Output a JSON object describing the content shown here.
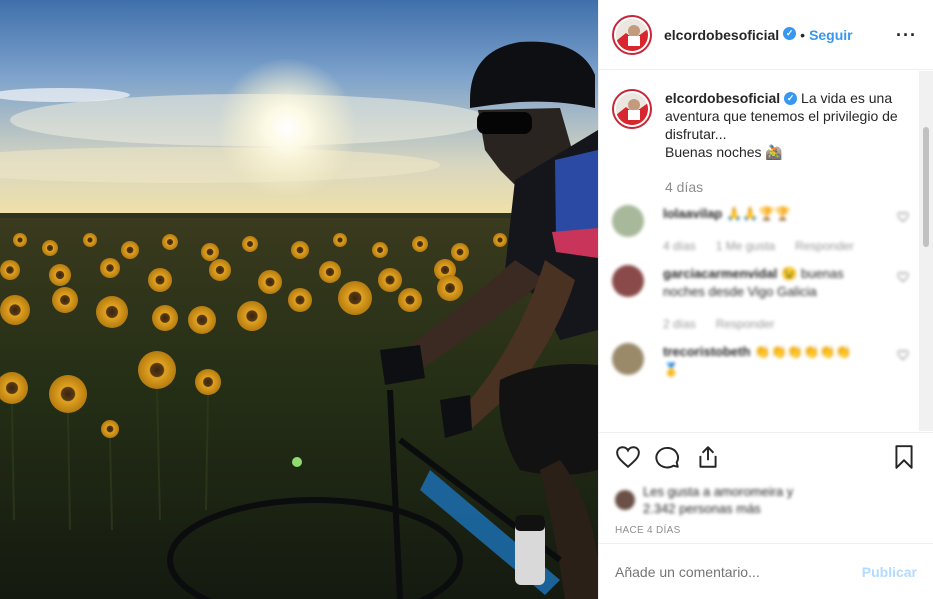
{
  "post": {
    "username": "elcordobesoficial",
    "follow_label": "Seguir",
    "dot": "•",
    "more_icon": "more-options-icon",
    "caption_line1": "La vida es una aventura que tenemos el privilegio de disfrutar...",
    "caption_line2": "Buenas noches 🚵",
    "caption_age": "4 días"
  },
  "comments": [
    {
      "user": "lolaavilap",
      "text": "🙏🙏🏆🏆",
      "age": "4 días",
      "likes": "1 Me gusta",
      "reply": "Responder",
      "avatar_color": "#a8b89a"
    },
    {
      "user": "garciacarmenvidal",
      "text": "😉 buenas noches desde Vigo Galicia",
      "age": "2 días",
      "likes": "",
      "reply": "Responder",
      "avatar_color": "#8a4a4a"
    },
    {
      "user": "trecoristobeth",
      "text": "👏👏👏👏👏👏 🥇",
      "age": "",
      "likes": "",
      "reply": "",
      "avatar_color": "#9a8a6a"
    }
  ],
  "actions": {
    "like_icon": "heart-icon",
    "comment_icon": "comment-icon",
    "share_icon": "share-icon",
    "save_icon": "bookmark-icon",
    "likes_line1": "Les gusta a amoromeira y",
    "likes_line2": "2.342 personas más",
    "timestamp": "HACE 4 DÍAS"
  },
  "composer": {
    "placeholder": "Añade un comentario...",
    "publish_label": "Publicar"
  },
  "colors": {
    "accent": "#3897f0",
    "publish_disabled": "#b3dbff",
    "meta_grey": "#8e8e8e"
  }
}
